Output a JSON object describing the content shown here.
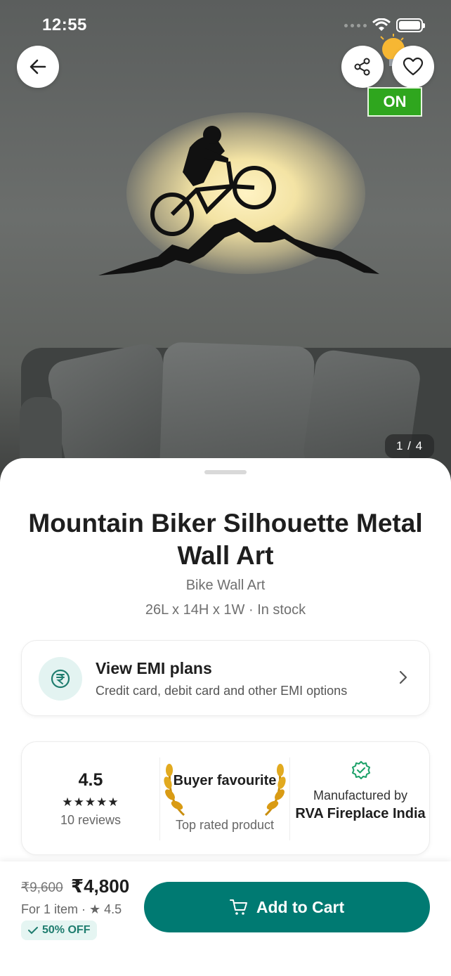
{
  "status_bar": {
    "time": "12:55"
  },
  "gallery": {
    "counter": "1 / 4",
    "on_badge": "ON"
  },
  "product": {
    "title": "Mountain Biker Silhouette Metal Wall Art",
    "category": "Bike Wall Art",
    "dimensions": "26L x 14H x 1W · In stock"
  },
  "emi": {
    "title": "View EMI plans",
    "subtitle": "Credit card, debit card and other EMI options"
  },
  "stats": {
    "rating": "4.5",
    "stars": "★★★★★",
    "reviews": "10 reviews",
    "badge_title": "Buyer favourite",
    "badge_sub": "Top rated product",
    "mfg_label": "Manufactured by",
    "mfg_name": "RVA Fireplace India"
  },
  "pricing": {
    "mrp": "₹9,600",
    "price": "₹4,800",
    "per_item": "For 1 item · ★ 4.5",
    "discount": "50% OFF"
  },
  "cart": {
    "label": "Add to Cart"
  },
  "colors": {
    "accent": "#007a72",
    "on_badge": "#2fa61e",
    "laurel": "#d4a017"
  },
  "icons": [
    "back-arrow-icon",
    "share-icon",
    "heart-icon",
    "bulb-icon",
    "rupee-icon",
    "chevron-right-icon",
    "laurel-icon",
    "verified-icon",
    "check-icon",
    "cart-icon"
  ]
}
